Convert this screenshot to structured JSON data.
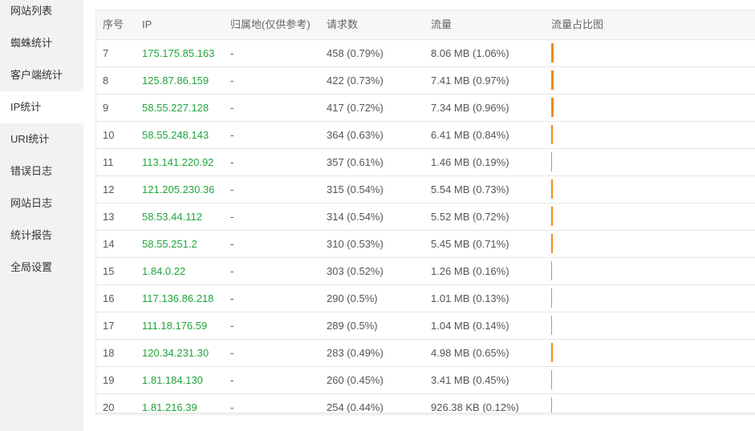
{
  "sidebar": {
    "items": [
      {
        "label": "网站列表",
        "active": false
      },
      {
        "label": "蜘蛛统计",
        "active": false
      },
      {
        "label": "客户端统计",
        "active": false
      },
      {
        "label": "IP统计",
        "active": true
      },
      {
        "label": "URI统计",
        "active": false
      },
      {
        "label": "错误日志",
        "active": false
      },
      {
        "label": "网站日志",
        "active": false
      },
      {
        "label": "统计报告",
        "active": false
      },
      {
        "label": "全局设置",
        "active": false
      }
    ]
  },
  "table": {
    "headers": [
      "序号",
      "IP",
      "归属地(仅供参考)",
      "请求数",
      "流量",
      "流量占比图"
    ],
    "rows": [
      {
        "index": "7",
        "ip": "175.175.85.163",
        "location": "-",
        "requests": "458 (0.79%)",
        "traffic": "8.06 MB (1.06%)",
        "share": 1.06
      },
      {
        "index": "8",
        "ip": "125.87.86.159",
        "location": "-",
        "requests": "422 (0.73%)",
        "traffic": "7.41 MB (0.97%)",
        "share": 0.97
      },
      {
        "index": "9",
        "ip": "58.55.227.128",
        "location": "-",
        "requests": "417 (0.72%)",
        "traffic": "7.34 MB (0.96%)",
        "share": 0.96
      },
      {
        "index": "10",
        "ip": "58.55.248.143",
        "location": "-",
        "requests": "364 (0.63%)",
        "traffic": "6.41 MB (0.84%)",
        "share": 0.84
      },
      {
        "index": "11",
        "ip": "113.141.220.92",
        "location": "-",
        "requests": "357 (0.61%)",
        "traffic": "1.46 MB (0.19%)",
        "share": 0.19
      },
      {
        "index": "12",
        "ip": "121.205.230.36",
        "location": "-",
        "requests": "315 (0.54%)",
        "traffic": "5.54 MB (0.73%)",
        "share": 0.73
      },
      {
        "index": "13",
        "ip": "58.53.44.112",
        "location": "-",
        "requests": "314 (0.54%)",
        "traffic": "5.52 MB (0.72%)",
        "share": 0.72
      },
      {
        "index": "14",
        "ip": "58.55.251.2",
        "location": "-",
        "requests": "310 (0.53%)",
        "traffic": "5.45 MB (0.71%)",
        "share": 0.71
      },
      {
        "index": "15",
        "ip": "1.84.0.22",
        "location": "-",
        "requests": "303 (0.52%)",
        "traffic": "1.26 MB (0.16%)",
        "share": 0.16
      },
      {
        "index": "16",
        "ip": "117.136.86.218",
        "location": "-",
        "requests": "290 (0.5%)",
        "traffic": "1.01 MB (0.13%)",
        "share": 0.13
      },
      {
        "index": "17",
        "ip": "111.18.176.59",
        "location": "-",
        "requests": "289 (0.5%)",
        "traffic": "1.04 MB (0.14%)",
        "share": 0.14
      },
      {
        "index": "18",
        "ip": "120.34.231.30",
        "location": "-",
        "requests": "283 (0.49%)",
        "traffic": "4.98 MB (0.65%)",
        "share": 0.65
      },
      {
        "index": "19",
        "ip": "1.81.184.130",
        "location": "-",
        "requests": "260 (0.45%)",
        "traffic": "3.41 MB (0.45%)",
        "share": 0.45
      },
      {
        "index": "20",
        "ip": "1.81.216.39",
        "location": "-",
        "requests": "254 (0.44%)",
        "traffic": "926.38 KB (0.12%)",
        "share": 0.12
      }
    ]
  },
  "colors": {
    "accent_green": "#20a53a",
    "bar_orange": "#f0891f",
    "sidebar_bg": "#f2f2f2"
  }
}
